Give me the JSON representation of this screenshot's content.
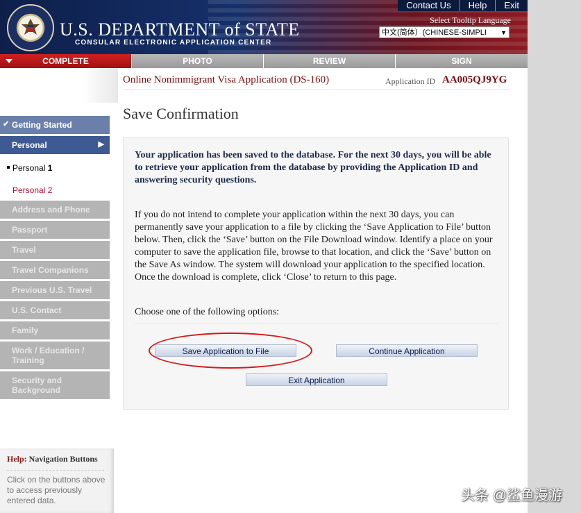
{
  "header": {
    "title_main": "U.S. DEPARTMENT of STATE",
    "title_sub": "CONSULAR ELECTRONIC APPLICATION CENTER",
    "top_links": [
      "Contact Us",
      "Help",
      "Exit"
    ],
    "tooltip_language_label": "Select Tooltip Language",
    "tooltip_language_value": "中文(简体）(CHINESE-SIMPLI"
  },
  "steps": [
    "COMPLETE",
    "PHOTO",
    "REVIEW",
    "SIGN"
  ],
  "form": {
    "application_title": "Online Nonimmigrant Visa Application (DS-160)",
    "application_id_label": "Application ID",
    "application_id": "AA005QJ9YG"
  },
  "nav": {
    "getting_started": "Getting Started",
    "personal": "Personal",
    "personal_1_prefix": "Personal",
    "personal_1_num": "1",
    "personal_2": "Personal 2",
    "items": [
      "Address and Phone",
      "Passport",
      "Travel",
      "Travel Companions",
      "Previous U.S. Travel",
      "U.S. Contact",
      "Family",
      "Work / Education / Training",
      "Security and Background"
    ]
  },
  "help": {
    "label": "Help:",
    "topic": "Navigation Buttons",
    "text": "Click on the buttons above to access previously entered data."
  },
  "main": {
    "page_title": "Save Confirmation",
    "bold_message": "Your application has been saved to the database. For the next 30 days, you will be able to retrieve your application from the database by providing the Application ID and answering security questions.",
    "instructions": "If you do not intend to complete your application within the next 30 days, you can permanently save your application to a file by clicking the ‘Save Application to File’ button below. Then, click the ‘Save’ button on the File Download window. Identify a place on your computer to save the application file, browse to that location, and click the ‘Save’ button on the Save As window. The system will download your application to the specified location. Once the download is complete, click ‘Close’ to return to this page.",
    "choose_text": "Choose one of the following options:",
    "buttons": {
      "save": "Save Application to File",
      "continue": "Continue Application",
      "exit": "Exit Application"
    }
  },
  "watermark": "头条 @鲨鱼漫游",
  "colors": {
    "accent_red": "#7a1010",
    "nav_active": "#3e5a93",
    "annotation_red": "#d41a1a"
  }
}
